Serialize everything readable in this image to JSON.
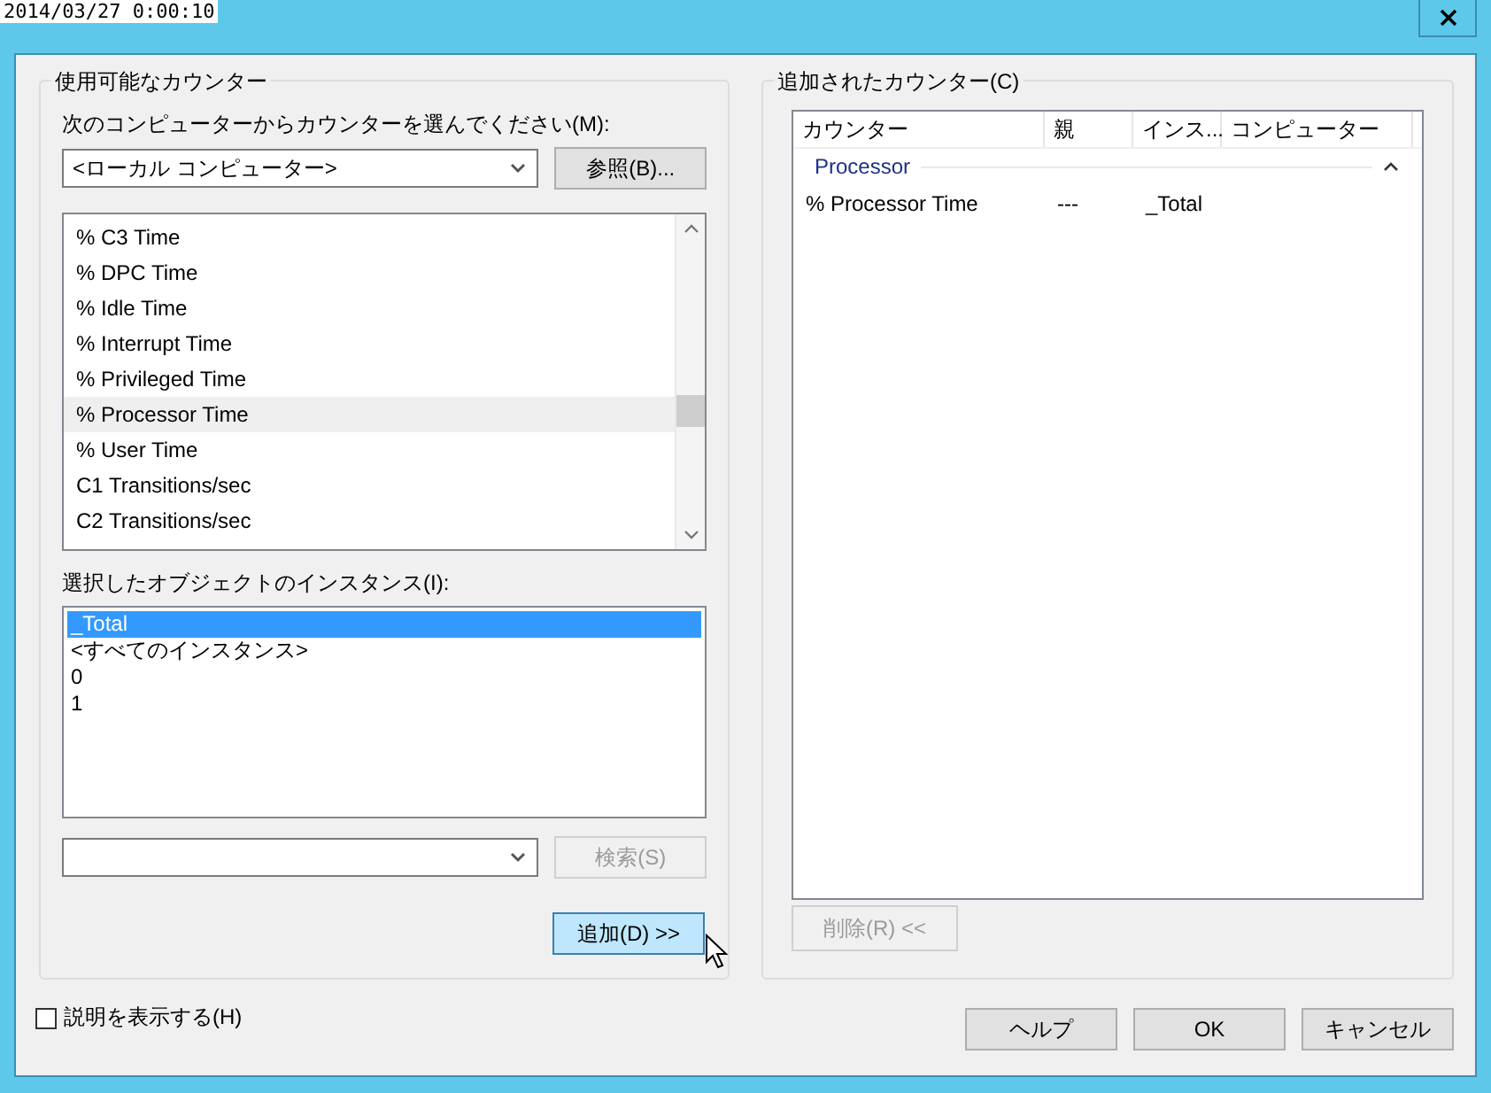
{
  "timestamp": "2014/03/27 0:00:10",
  "available_counters": {
    "title": "使用可能なカウンター",
    "computer_label": "次のコンピューターからカウンターを選んでください(M):",
    "computer_value": "<ローカル コンピューター>",
    "browse_button": "参照(B)...",
    "counters": [
      {
        "label": "% C3 Time",
        "selected": false
      },
      {
        "label": "% DPC Time",
        "selected": false
      },
      {
        "label": "% Idle Time",
        "selected": false
      },
      {
        "label": "% Interrupt Time",
        "selected": false
      },
      {
        "label": "% Privileged Time",
        "selected": false
      },
      {
        "label": "% Processor Time",
        "selected": true
      },
      {
        "label": "% User Time",
        "selected": false
      },
      {
        "label": "C1 Transitions/sec",
        "selected": false
      },
      {
        "label": "C2 Transitions/sec",
        "selected": false
      }
    ],
    "instances_label": "選択したオブジェクトのインスタンス(I):",
    "instances": [
      {
        "label": "_Total",
        "selected": true
      },
      {
        "label": "<すべてのインスタンス>",
        "selected": false
      },
      {
        "label": "0",
        "selected": false
      },
      {
        "label": "1",
        "selected": false
      }
    ],
    "search_button": {
      "label": "検索(S)",
      "disabled": true
    },
    "add_button": {
      "label": "追加(D) >>",
      "disabled": false
    }
  },
  "added_counters": {
    "title": "追加されたカウンター(C)",
    "columns": [
      "カウンター",
      "親",
      "インス...",
      "コンピューター"
    ],
    "groups": [
      {
        "name": "Processor",
        "expanded": true,
        "rows": [
          {
            "counter": "% Processor Time",
            "parent": "---",
            "instance": "_Total"
          }
        ]
      }
    ],
    "remove_button": {
      "label": "削除(R) <<",
      "disabled": true
    }
  },
  "show_description": {
    "label": "説明を表示する(H)",
    "checked": false
  },
  "buttons": [
    "ヘルプ",
    "OK",
    "キャンセル"
  ]
}
